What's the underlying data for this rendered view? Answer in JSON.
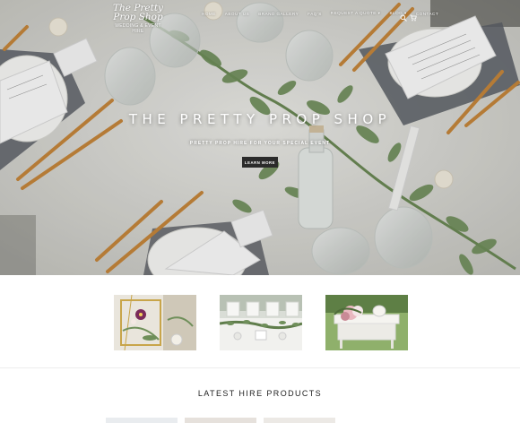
{
  "header": {
    "logo_script_line1": "The Pretty",
    "logo_script_line2": "Prop Shop",
    "logo_tagline": "WEDDING & EVENT HIRE",
    "nav": [
      {
        "label": "HOME"
      },
      {
        "label": "ABOUT US"
      },
      {
        "label": "BRAND GALLERY"
      },
      {
        "label": "FAQ'S"
      },
      {
        "label": "REQUEST A QUOTE ▾"
      },
      {
        "label": "BLOG ▾"
      },
      {
        "label": "CONTACT"
      }
    ],
    "search_icon": "search-icon",
    "cart_icon": "cart-icon",
    "cart_count": "0"
  },
  "hero": {
    "title": "THE PRETTY PROP SHOP",
    "subtitle": "PRETTY PROP HIRE FOR YOUR SPECIAL EVENT",
    "button_label": "LEARN MORE"
  },
  "gallery": {
    "thumbnails": [
      {
        "alt": "Gold frame with flowers"
      },
      {
        "alt": "Table with white chairs and greenery"
      },
      {
        "alt": "Outdoor floral table setting"
      }
    ]
  },
  "products": {
    "title": "LATEST HIRE PRODUCTS"
  },
  "colors": {
    "accent_dark": "#2b2b2b",
    "white": "#ffffff",
    "leaf_green": "#6f8f5a",
    "gold": "#c8873a"
  }
}
